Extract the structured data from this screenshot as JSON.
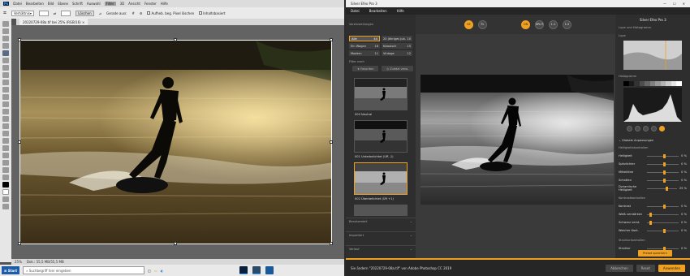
{
  "photoshop": {
    "menu": [
      "Datei",
      "Bearbeiten",
      "Bild",
      "Ebene",
      "Schrift",
      "Auswahl",
      "Filter",
      "3D",
      "Ansicht",
      "Fenster",
      "Hilfe"
    ],
    "menu_active_index": 6,
    "options": {
      "style": "Verhältnis",
      "clear_label": "Löschen",
      "straighten_label": "Gerade ausr.",
      "delete_pixels_label": "Aufheb. beg. Pixel löschen",
      "content_aware_label": "Inhaltsbasiert"
    },
    "document_tab": "20220729-08a.tif bei 25% (RGB/16)",
    "status": {
      "zoom": "25%",
      "doc": "Dok.: 55,5 MB/55,5 MB"
    }
  },
  "taskbar": {
    "start_label": "Start",
    "search_placeholder": "Suchbegriff hier eingeben"
  },
  "silver_efex": {
    "title": "Silver Efex Pro 3",
    "menu": [
      "Datei",
      "Bearbeiten",
      "Hilfe"
    ],
    "left_panel": {
      "header": "Voreinstellungen",
      "categories": [
        {
          "name": "Alle",
          "count": "44"
        },
        {
          "name": "20 jähriges Jub.",
          "count": "10"
        },
        {
          "name": "Ein Wagen",
          "count": "16"
        },
        {
          "name": "Klassisch",
          "count": "15"
        },
        {
          "name": "Modern",
          "count": "11"
        },
        {
          "name": "Vintage",
          "count": "12"
        }
      ],
      "filter_label": "Filter nach",
      "fav_button": "Favoriten",
      "recent_button": "Zuletzt verw.",
      "presets": [
        {
          "label": "000 Neutral"
        },
        {
          "label": "001 Unterbelichtet (UR -1)"
        },
        {
          "label": "002 Überbelichtet (ÜR +1)"
        }
      ],
      "sections": [
        "Benutzerdef.",
        "Importiert",
        "Verlauf"
      ]
    },
    "toolbar": {
      "buttons": [
        "SE",
        "FL",
        "C"
      ],
      "view_buttons": [
        "ON",
        "SPLIT",
        "1:1",
        "1:2"
      ]
    },
    "right_panel": {
      "brand": "Silver Efex Pro 3",
      "loupe_label": "Lupe und Histogramm",
      "loupe_sub": "Lupe",
      "histogram_label": "Histogramm",
      "zones": [
        "0",
        "1",
        "2",
        "3",
        "4",
        "5",
        "6",
        "7",
        "8",
        "9",
        "10"
      ],
      "global_label": "Globale Anpassungen",
      "brightness_header": "Helligkeitskontrollen",
      "brightness_sliders": [
        {
          "label": "Helligkeit",
          "value": "0 %"
        },
        {
          "label": "Spitzlichter",
          "value": "0 %"
        },
        {
          "label": "Mitteltöne",
          "value": "0 %"
        },
        {
          "label": "Schatten",
          "value": "0 %"
        },
        {
          "label": "Dynamische Helligkeit",
          "value": "25 %"
        }
      ],
      "contrast_header": "Kontrastkontrollen",
      "contrast_sliders": [
        {
          "label": "Kontrast",
          "value": "0 %"
        },
        {
          "label": "Weiß verstärken",
          "value": "0 %"
        },
        {
          "label": "Schwarz verst.",
          "value": "0 %"
        },
        {
          "label": "Weicher Kont.",
          "value": "0 %"
        }
      ],
      "structure_header": "Strukturkontrollen",
      "structure_sliders": [
        {
          "label": "Struktur",
          "value": "0 %"
        }
      ],
      "save_preset": "Preset speichern"
    },
    "footer": {
      "message": "Sie ändern \"20220729-08a.tif\" von Adobe Photoshop CC 2019",
      "cancel": "Abbrechen",
      "reset": "Reset",
      "apply": "Anwenden"
    }
  },
  "colors": {
    "accent": "#f0a020",
    "ps_bg": "#535353",
    "se_bg": "#3a3a3a"
  }
}
